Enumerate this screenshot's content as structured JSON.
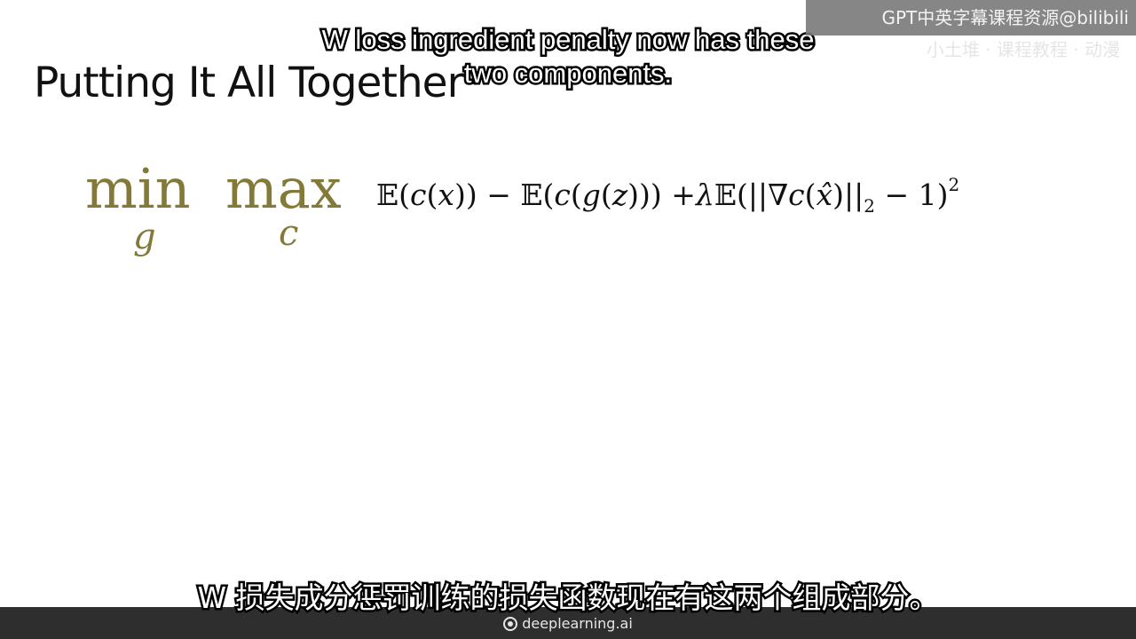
{
  "slide": {
    "title": "Putting It All Together"
  },
  "formula": {
    "min_word": "min",
    "min_subscript": "g",
    "max_word": "max",
    "max_subscript": "c",
    "part1": "𝔼(",
    "part2": "c",
    "part3": "(",
    "part4": "x",
    "part5": ")) − 𝔼(",
    "part6": "c",
    "part7": "(",
    "part8": "g",
    "part9": "(",
    "part10": "z",
    "part11": "))) +",
    "part12": "λ",
    "part13": "𝔼(||∇",
    "part14": "c",
    "part15": "(",
    "part16": "x̂",
    "part17": ")||",
    "part18": "2",
    "part19": " − 1)",
    "part20": "2"
  },
  "subtitles": {
    "english": "W loss ingredient penalty now has these two components.",
    "chinese": "W 损失成分惩罚训练的损失函数现在有这两个组成部分。"
  },
  "watermark": {
    "text": "GPT中英字幕课程资源@bilibili",
    "ghost_text": "小土堆 · 课程教程 · 动漫"
  },
  "footer": {
    "brand": "deeplearning.ai"
  }
}
